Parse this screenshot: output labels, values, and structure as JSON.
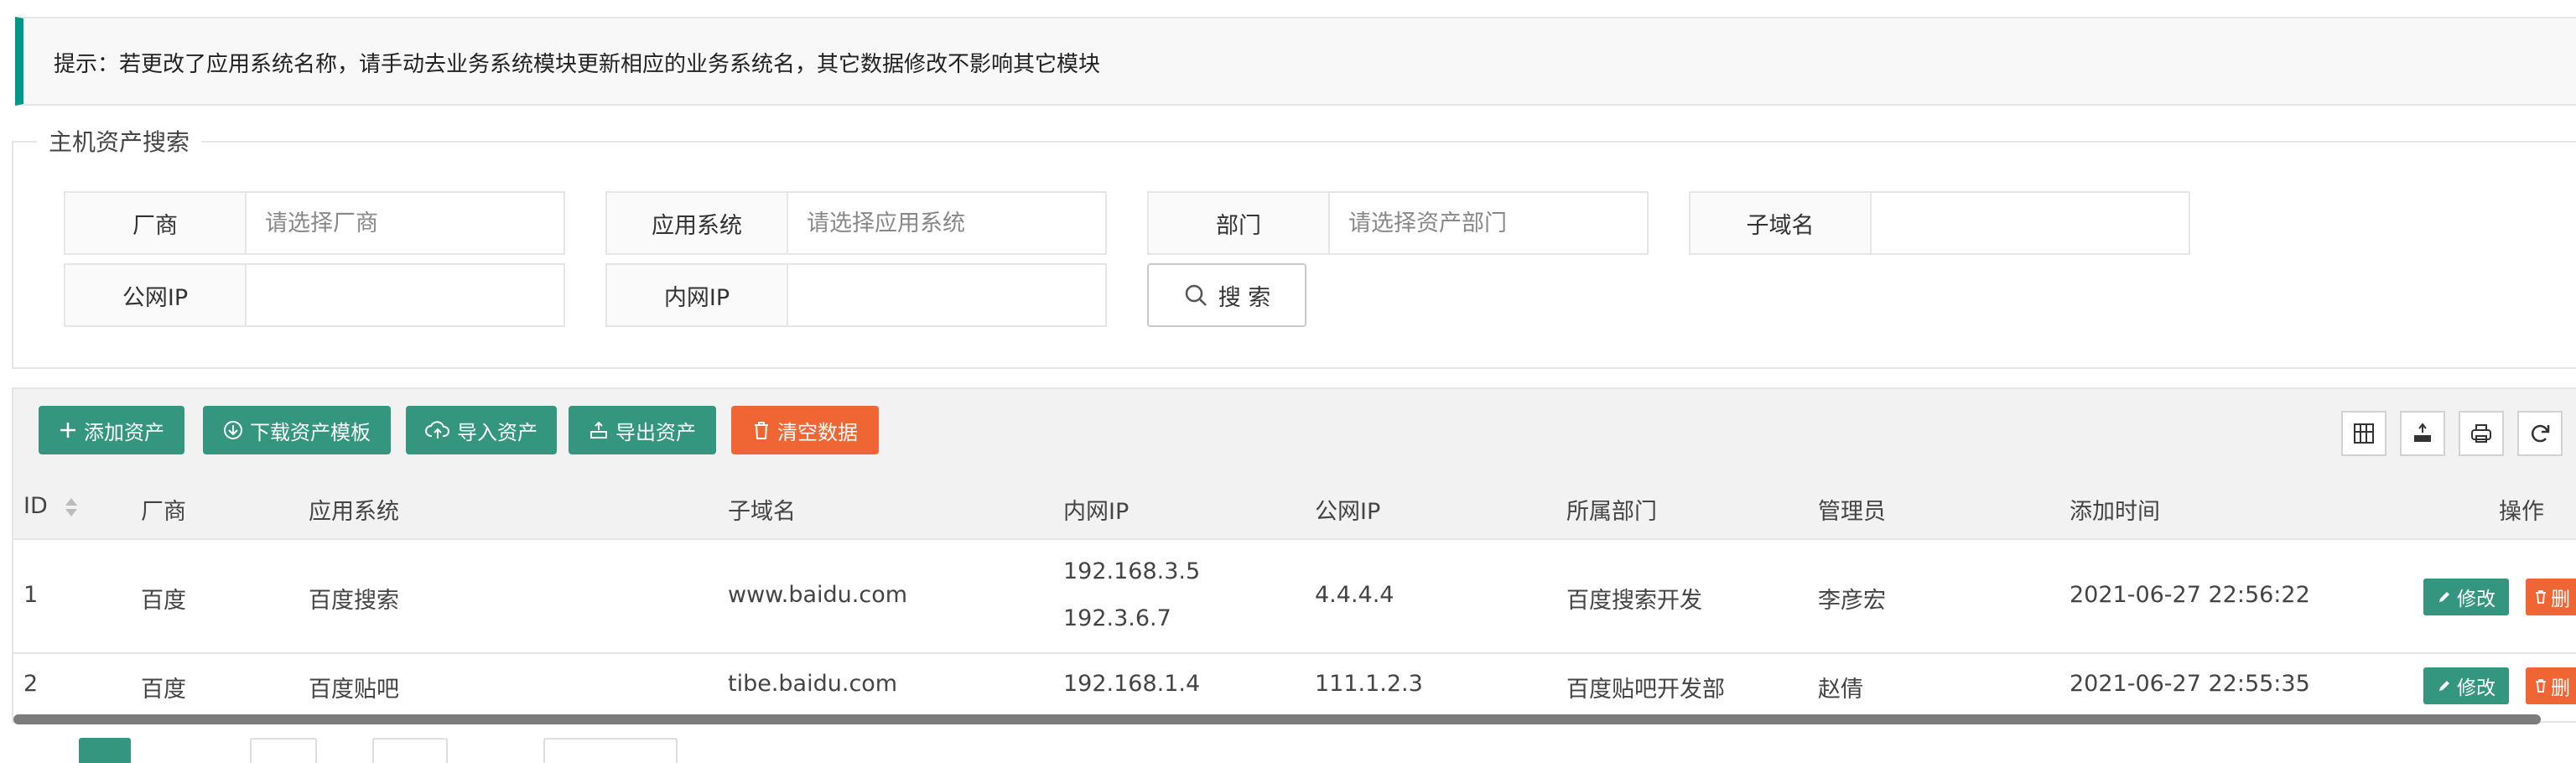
{
  "notice": {
    "text": "提示：若更改了应用系统名称，请手动去业务系统模块更新相应的业务系统名，其它数据修改不影响其它模块"
  },
  "search": {
    "legend": "主机资产搜索",
    "fields": [
      {
        "label": "厂商",
        "placeholder": "请选择厂商",
        "value": ""
      },
      {
        "label": "应用系统",
        "placeholder": "请选择应用系统",
        "value": ""
      },
      {
        "label": "部门",
        "placeholder": "请选择资产部门",
        "value": ""
      },
      {
        "label": "子域名",
        "placeholder": "",
        "value": ""
      },
      {
        "label": "公网IP",
        "placeholder": "",
        "value": ""
      },
      {
        "label": "内网IP",
        "placeholder": "",
        "value": ""
      }
    ],
    "button_label": "搜 索"
  },
  "toolbar": {
    "buttons": [
      {
        "label": "添加资产",
        "icon": "plus-icon",
        "color": "#34967f"
      },
      {
        "label": "下载资产模板",
        "icon": "download-icon",
        "color": "#34967f"
      },
      {
        "label": "导入资产",
        "icon": "upload-cloud-icon",
        "color": "#34967f"
      },
      {
        "label": "导出资产",
        "icon": "export-icon",
        "color": "#34967f"
      },
      {
        "label": "清空数据",
        "icon": "trash-icon",
        "color": "#ef6533"
      }
    ],
    "tools": [
      "columns-icon",
      "export-icon",
      "print-icon",
      "refresh-icon"
    ]
  },
  "table": {
    "columns": [
      "ID",
      "厂商",
      "应用系统",
      "子域名",
      "内网IP",
      "公网IP",
      "所属部门",
      "管理员",
      "添加时间",
      "操作"
    ],
    "rows": [
      {
        "id": "1",
        "vendor": "百度",
        "system": "百度搜索",
        "subdomain": "www.baidu.com",
        "intranet_ip": [
          "192.168.3.5",
          "192.3.6.7"
        ],
        "public_ip": "4.4.4.4",
        "department": "百度搜索开发",
        "admin": "李彦宏",
        "added_time": "2021-06-27 22:56:22"
      },
      {
        "id": "2",
        "vendor": "百度",
        "system": "百度贴吧",
        "subdomain": "tibe.baidu.com",
        "intranet_ip": [
          "192.168.1.4"
        ],
        "public_ip": "111.1.2.3",
        "department": "百度贴吧开发部",
        "admin": "赵倩",
        "added_time": "2021-06-27 22:55:35"
      }
    ],
    "edit_label": "修改",
    "delete_label": "删"
  },
  "colors": {
    "primary": "#34967f",
    "danger": "#ef6533",
    "border": "#e6e6e6"
  }
}
